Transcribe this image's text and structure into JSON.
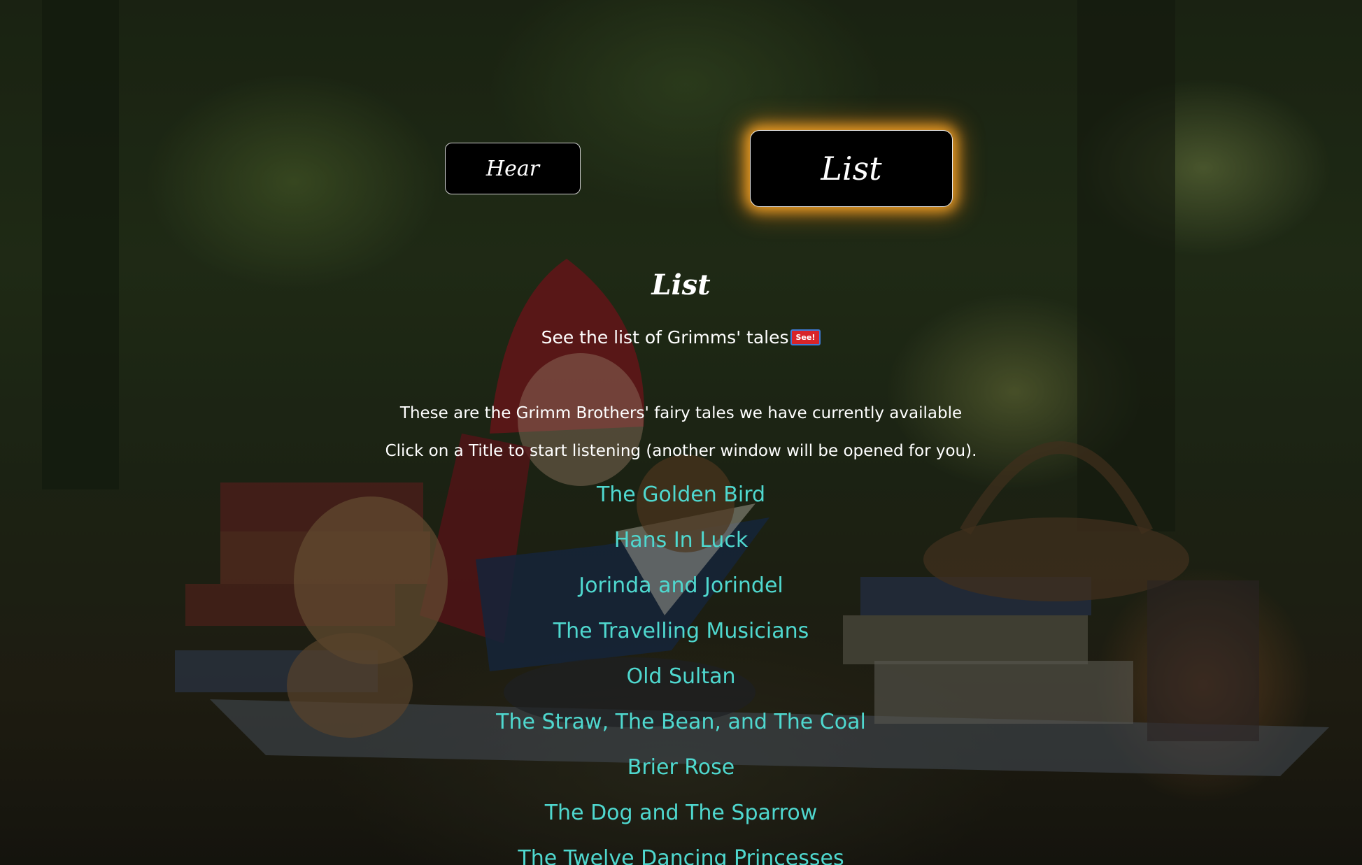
{
  "nav": {
    "hear_label": "Hear",
    "list_label": "List"
  },
  "section": {
    "title": "List",
    "subtitle": "See the list of Grimms' tales",
    "badge": "See!"
  },
  "intro": {
    "line1": "These are the Grimm Brothers' fairy tales we have currently available",
    "line2": "Click on a Title to start listening (another window will be opened for you)."
  },
  "tales": [
    "The Golden Bird",
    "Hans In Luck",
    "Jorinda and Jorindel",
    "The Travelling Musicians",
    "Old Sultan",
    "The Straw, The Bean, and The Coal",
    "Brier Rose",
    "The Dog and The Sparrow",
    "The Twelve Dancing Princesses"
  ],
  "colors": {
    "link": "#4fd8cf",
    "active_glow": "#ffaa28",
    "badge": "#d8242a"
  }
}
